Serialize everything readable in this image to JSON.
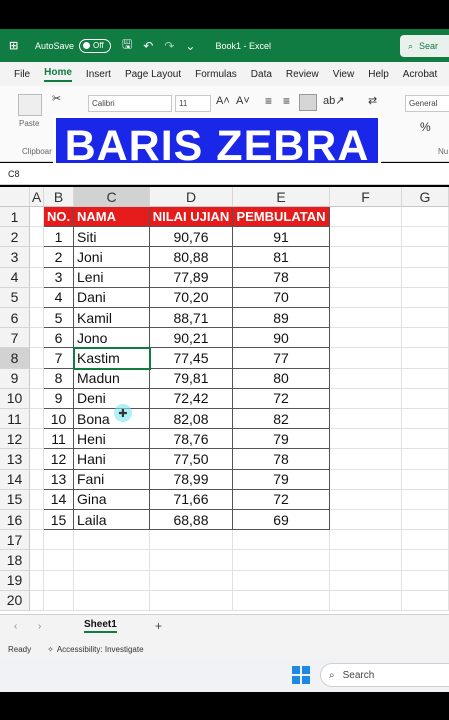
{
  "titlebar": {
    "autosave_label": "AutoSave",
    "autosave_state": "Off",
    "doc_title": "Book1 - Excel",
    "search_label": "Sear"
  },
  "menu": [
    "File",
    "Home",
    "Insert",
    "Page Layout",
    "Formulas",
    "Data",
    "Review",
    "View",
    "Help",
    "Acrobat"
  ],
  "ribbon": {
    "paste_label": "Paste",
    "clipboard_label": "Clipboar",
    "font_name": "Calibri",
    "font_size": "11",
    "number_format": "General",
    "number_group_label": "Nu"
  },
  "banner_text": "BARIS ZEBRA",
  "name_box": "C8",
  "columns": [
    "A",
    "B",
    "C",
    "D",
    "E",
    "F",
    "G"
  ],
  "row_numbers": [
    "1",
    "2",
    "3",
    "4",
    "5",
    "6",
    "7",
    "8",
    "9",
    "10",
    "11",
    "12",
    "13",
    "14",
    "15",
    "16",
    "17",
    "18",
    "19",
    "20"
  ],
  "table": {
    "headers": [
      "NO.",
      "NAMA",
      "NILAI UJIAN",
      "PEMBULATAN"
    ],
    "rows": [
      [
        "1",
        "Siti",
        "90,76",
        "91"
      ],
      [
        "2",
        "Joni",
        "80,88",
        "81"
      ],
      [
        "3",
        "Leni",
        "77,89",
        "78"
      ],
      [
        "4",
        "Dani",
        "70,20",
        "70"
      ],
      [
        "5",
        "Kamil",
        "88,71",
        "89"
      ],
      [
        "6",
        "Jono",
        "90,21",
        "90"
      ],
      [
        "7",
        "Kastim",
        "77,45",
        "77"
      ],
      [
        "8",
        "Madun",
        "79,81",
        "80"
      ],
      [
        "9",
        "Deni",
        "72,42",
        "72"
      ],
      [
        "10",
        "Bona",
        "82,08",
        "82"
      ],
      [
        "11",
        "Heni",
        "78,76",
        "79"
      ],
      [
        "12",
        "Hani",
        "77,50",
        "78"
      ],
      [
        "13",
        "Fani",
        "78,99",
        "79"
      ],
      [
        "14",
        "Gina",
        "71,66",
        "72"
      ],
      [
        "15",
        "Laila",
        "68,88",
        "69"
      ]
    ]
  },
  "sheet_tab": "Sheet1",
  "status": {
    "ready": "Ready",
    "accessibility": "Accessibility: Investigate"
  },
  "taskbar": {
    "search_label": "Search"
  },
  "colors": {
    "excel_green": "#107c41",
    "header_red": "#e61c1c",
    "banner_blue": "#1a27e8"
  }
}
